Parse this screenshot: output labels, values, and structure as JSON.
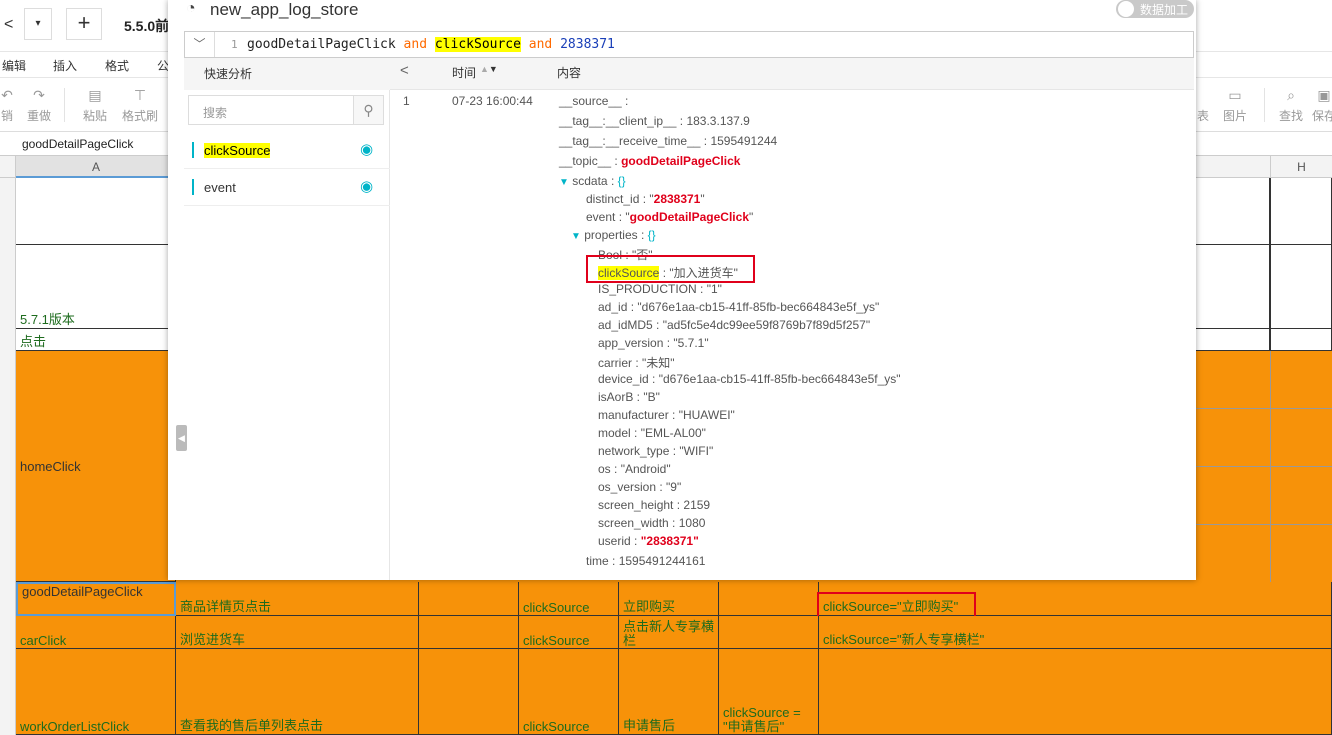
{
  "sheet": {
    "topbar": {
      "back_glyph": "<",
      "dropdown_glyph": "▾",
      "add_glyph": "+",
      "doc_title": "5.5.0前"
    },
    "menu": [
      "编辑",
      "插入",
      "格式",
      "公"
    ],
    "toolbar": {
      "left": [
        {
          "icon": "undo-icon",
          "label": "销"
        },
        {
          "icon": "redo-icon",
          "label": "重做"
        },
        {
          "icon": "paste-icon",
          "label": "粘贴"
        },
        {
          "icon": "format-painter-icon",
          "label": "格式刷"
        }
      ],
      "right": [
        {
          "icon": "table-icon",
          "label": "表"
        },
        {
          "icon": "image-icon",
          "label": "图片"
        },
        {
          "icon": "find-icon",
          "label": "查找"
        },
        {
          "icon": "save-icon",
          "label": "保存"
        }
      ]
    },
    "formula_value": "goodDetailPageClick",
    "col_headers": {
      "a": "A",
      "h": "H"
    },
    "cells": {
      "version": "5.7.1版本",
      "click": "点击",
      "homeClick": "homeClick",
      "row_good": [
        "goodDetailPageClick",
        "商品详情页点击",
        "",
        "clickSource",
        "立即购买",
        "",
        "clickSource=\"立即购买\""
      ],
      "row_car": [
        "carClick",
        "浏览进货车",
        "",
        "clickSource",
        "点击新人专享横栏",
        "",
        "clickSource=\"新人专享横栏\""
      ],
      "row_work": [
        "workOrderListClick",
        "查看我的售后单列表点击",
        "",
        "clickSource",
        "申请售后",
        "clickSource =\n\"申请售后\"",
        ""
      ]
    }
  },
  "log": {
    "store_name": "new_app_log_store",
    "toggle_label": "数据加工",
    "query": {
      "line_no": "1",
      "t1": "goodDetailPageClick",
      "and1": "and",
      "t2": "clickSource",
      "and2": "and",
      "t3": "2838371"
    },
    "quick_analysis": {
      "title": "快速分析",
      "search_placeholder": "搜索",
      "fields": [
        "clickSource",
        "event"
      ]
    },
    "table_headers": {
      "prev": "<",
      "time": "时间",
      "content": "内容"
    },
    "row_index": "1",
    "row_time": "07-23 16:00:44",
    "content": {
      "source_k": "__source__",
      "source_v": "",
      "client_ip_k": "__tag__:__client_ip__",
      "client_ip_v": "183.3.137.9",
      "receive_time_k": "__tag__:__receive_time__",
      "receive_time_v": "1595491244",
      "topic_k": "__topic__",
      "topic_v": "goodDetailPageClick",
      "scdata_k": "scdata",
      "scdata_v": "{}",
      "distinct_id_k": "distinct_id",
      "distinct_id_v": "2838371",
      "event_k": "event",
      "event_v": "goodDetailPageClick",
      "properties_k": "properties",
      "properties_v": "{}",
      "props": [
        {
          "k": "Bool",
          "v": "\"否\""
        },
        {
          "k": "clickSource",
          "v": "\"加入进货车\""
        },
        {
          "k": "IS_PRODUCTION",
          "v": "\"1\""
        },
        {
          "k": "ad_id",
          "v": "\"d676e1aa-cb15-41ff-85fb-bec664843e5f_ys\""
        },
        {
          "k": "ad_idMD5",
          "v": "\"ad5fc5e4dc99ee59f8769b7f89d5f257\""
        },
        {
          "k": "app_version",
          "v": "\"5.7.1\""
        },
        {
          "k": "carrier",
          "v": "\"未知\""
        },
        {
          "k": "device_id",
          "v": "\"d676e1aa-cb15-41ff-85fb-bec664843e5f_ys\""
        },
        {
          "k": "isAorB",
          "v": "\"B\""
        },
        {
          "k": "manufacturer",
          "v": "\"HUAWEI\""
        },
        {
          "k": "model",
          "v": "\"EML-AL00\""
        },
        {
          "k": "network_type",
          "v": "\"WIFI\""
        },
        {
          "k": "os",
          "v": "\"Android\""
        },
        {
          "k": "os_version",
          "v": "\"9\""
        },
        {
          "k": "screen_height",
          "v": "2159"
        },
        {
          "k": "screen_width",
          "v": "1080"
        },
        {
          "k": "userid",
          "v": "\"2838371\""
        }
      ],
      "time_k": "time",
      "time_v": "1595491244161"
    }
  },
  "colors": {
    "orange": "#f79209",
    "teal": "#00b4c8",
    "red_box": "#e0001b",
    "highlight": "#ffff00"
  }
}
